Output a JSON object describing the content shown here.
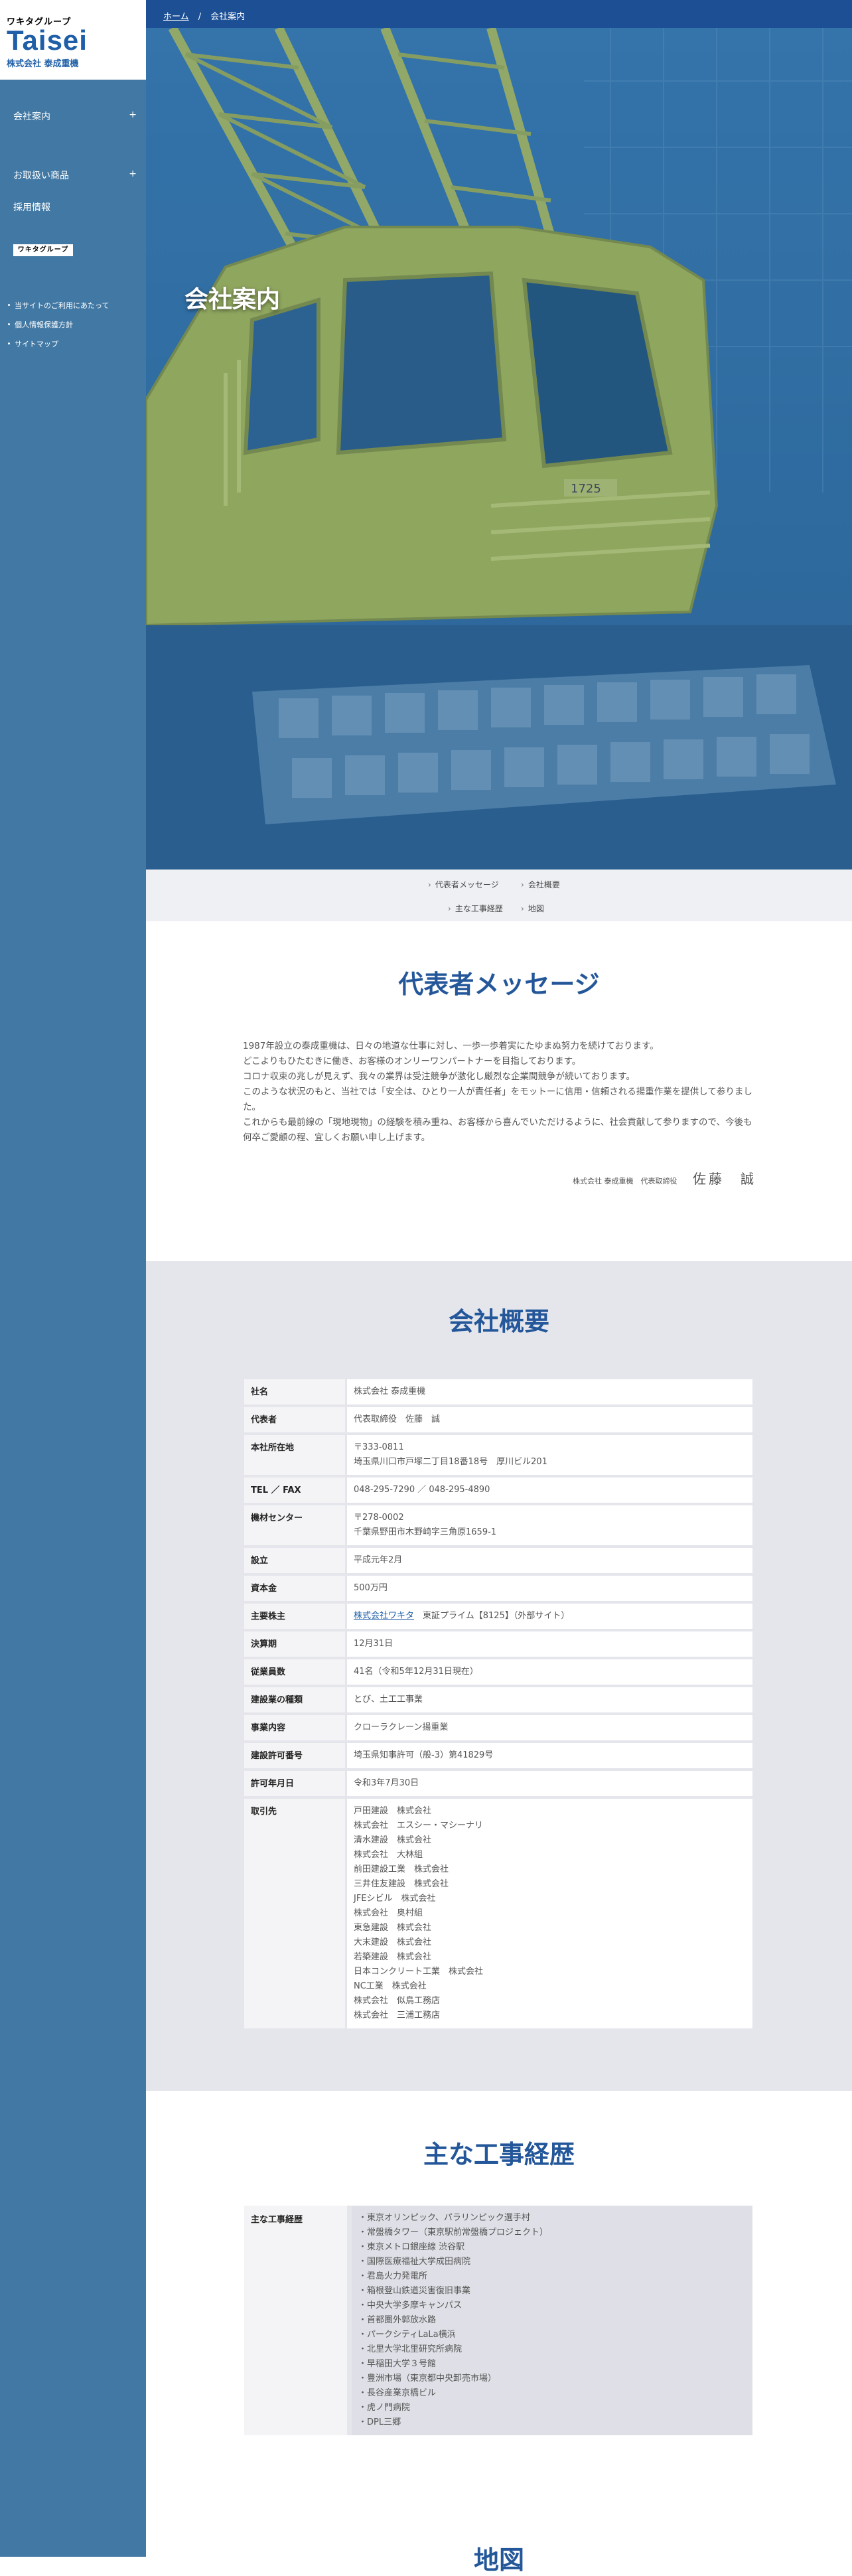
{
  "logo": {
    "group": "ワキタグループ",
    "brand": "Taisei",
    "company": "株式会社 泰成重機"
  },
  "nav": {
    "items": [
      {
        "label": "会社案内",
        "expand": "+"
      },
      {
        "label": "お取扱い商品",
        "expand": "+"
      },
      {
        "label": "採用情報",
        "expand": ""
      }
    ],
    "group_banner": "ワキタグループ",
    "links": [
      "当サイトのご利用にあたって",
      "個人情報保護方針",
      "サイトマップ"
    ]
  },
  "breadcrumb": {
    "home": "ホーム",
    "separator": "/",
    "current": "会社案内"
  },
  "hero": {
    "title": "会社案内",
    "crane_number": "1725"
  },
  "anchors": [
    "代表者メッセージ",
    "会社概要",
    "主な工事経歴",
    "地図"
  ],
  "message": {
    "title": "代表者メッセージ",
    "paragraphs": [
      "1987年設立の泰成重機は、日々の地道な仕事に対し、一歩一歩着実にたゆまぬ努力を続けております。",
      "どこよりもひたむきに働き、お客様のオンリーワンパートナーを目指しております。",
      "コロナ収束の兆しが見えず、我々の業界は受注競争が激化し厳烈な企業間競争が続いております。",
      "このような状況のもと、当社では「安全は、ひとり一人が責任者」をモットーに信用・信頼される揚重作業を提供して参りました。",
      "これからも最前線の「現地現物」の経験を積み重ね、お客様から喜んでいただけるように、社会貢献して参りますので、今後も何卒ご愛顧の程、宜しくお願い申し上げます。"
    ],
    "signature_title": "株式会社 泰成重機　代表取締役",
    "signature_name": "佐藤　誠"
  },
  "overview": {
    "title": "会社概要",
    "rows": [
      {
        "label": "社名",
        "value": "株式会社 泰成重機"
      },
      {
        "label": "代表者",
        "value": "代表取締役　佐藤　誠"
      },
      {
        "label": "本社所在地",
        "value": "〒333-0811\n埼玉県川口市戸塚二丁目18番18号　厚川ビル201"
      },
      {
        "label": "TEL ／ FAX",
        "value": "048-295-7290 ／ 048-295-4890"
      },
      {
        "label": "機材センター",
        "value": "〒278-0002\n千葉県野田市木野崎字三角原1659-1"
      },
      {
        "label": "設立",
        "value": "平成元年2月"
      },
      {
        "label": "資本金",
        "value": "500万円"
      },
      {
        "label": "主要株主",
        "link": "株式会社ワキタ",
        "value": "　東証プライム【8125】（外部サイト）"
      },
      {
        "label": "決算期",
        "value": "12月31日"
      },
      {
        "label": "従業員数",
        "value": "41名（令和5年12月31日現在）"
      },
      {
        "label": "建設業の種類",
        "value": "とび、土工工事業"
      },
      {
        "label": "事業内容",
        "value": "クローラクレーン揚重業"
      },
      {
        "label": "建設許可番号",
        "value": "埼玉県知事許可（般-3）第41829号"
      },
      {
        "label": "許可年月日",
        "value": "令和3年7月30日"
      },
      {
        "label": "取引先",
        "value": "戸田建設　株式会社\n株式会社　エスシー・マシーナリ\n清水建設　株式会社\n株式会社　大林組\n前田建設工業　株式会社\n三井住友建設　株式会社\nJFEシビル　株式会社\n株式会社　奥村組\n東急建設　株式会社\n大末建設　株式会社\n若築建設　株式会社\n日本コンクリート工業　株式会社\nNC工業　株式会社\n株式会社　似鳥工務店\n株式会社　三浦工務店"
      }
    ]
  },
  "works": {
    "title": "主な工事経歴",
    "label": "主な工事経歴",
    "items": [
      "・東京オリンピック、パラリンピック選手村",
      "・常盤橋タワー（東京駅前常盤橋プロジェクト）",
      "・東京メトロ銀座線 渋谷駅",
      "・国際医療福祉大学成田病院",
      "・君島火力発電所",
      "・箱根登山鉄道災害復旧事業",
      "・中央大学多摩キャンパス",
      "・首都圏外郭放水路",
      "・パークシティLaLa横浜",
      "・北里大学北里研究所病院",
      "・早稲田大学３号館",
      "・豊洲市場（東京都中央卸売市場）",
      "・長谷産業京橋ビル",
      "・虎ノ門病院",
      "・DPL三郷"
    ]
  },
  "map": {
    "title": "地図"
  },
  "colors": {
    "sidebar": "#4178a4",
    "breadcrumb": "#1c4f94",
    "heading": "#24579a",
    "section_gray": "#e5e6ec"
  }
}
